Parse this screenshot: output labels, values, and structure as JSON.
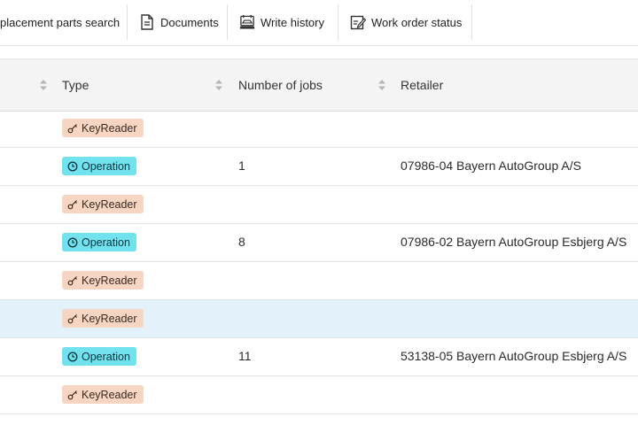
{
  "toolbar": {
    "items": [
      {
        "label": "placement parts search",
        "icon": ""
      },
      {
        "label": "Documents",
        "icon": "document-icon"
      },
      {
        "label": "Write history",
        "icon": "car-history-icon"
      },
      {
        "label": "Work order status",
        "icon": "edit-icon"
      }
    ]
  },
  "table": {
    "columns": [
      {
        "label": ""
      },
      {
        "label": "Type"
      },
      {
        "label": "Number of jobs"
      },
      {
        "label": "Retailer"
      }
    ],
    "rows": [
      {
        "type": "KeyReader",
        "jobs": "",
        "retailer": ""
      },
      {
        "type": "Operation",
        "jobs": "1",
        "retailer": "07986-04 Bayern AutoGroup A/S"
      },
      {
        "type": "KeyReader",
        "jobs": "",
        "retailer": ""
      },
      {
        "type": "Operation",
        "jobs": "8",
        "retailer": "07986-02 Bayern AutoGroup Esbjerg A/S"
      },
      {
        "type": "KeyReader",
        "jobs": "",
        "retailer": ""
      },
      {
        "type": "KeyReader",
        "jobs": "",
        "retailer": "",
        "selected": true
      },
      {
        "type": "Operation",
        "jobs": "11",
        "retailer": "53138-05 Bayern AutoGroup Esbjerg A/S"
      },
      {
        "type": "KeyReader",
        "jobs": "",
        "retailer": ""
      }
    ]
  },
  "colors": {
    "keyreader_badge": "#f6d6c2",
    "operation_badge": "#72e2ee",
    "selected_row": "#e3f1fb",
    "header_bg": "#f4f4f4"
  }
}
